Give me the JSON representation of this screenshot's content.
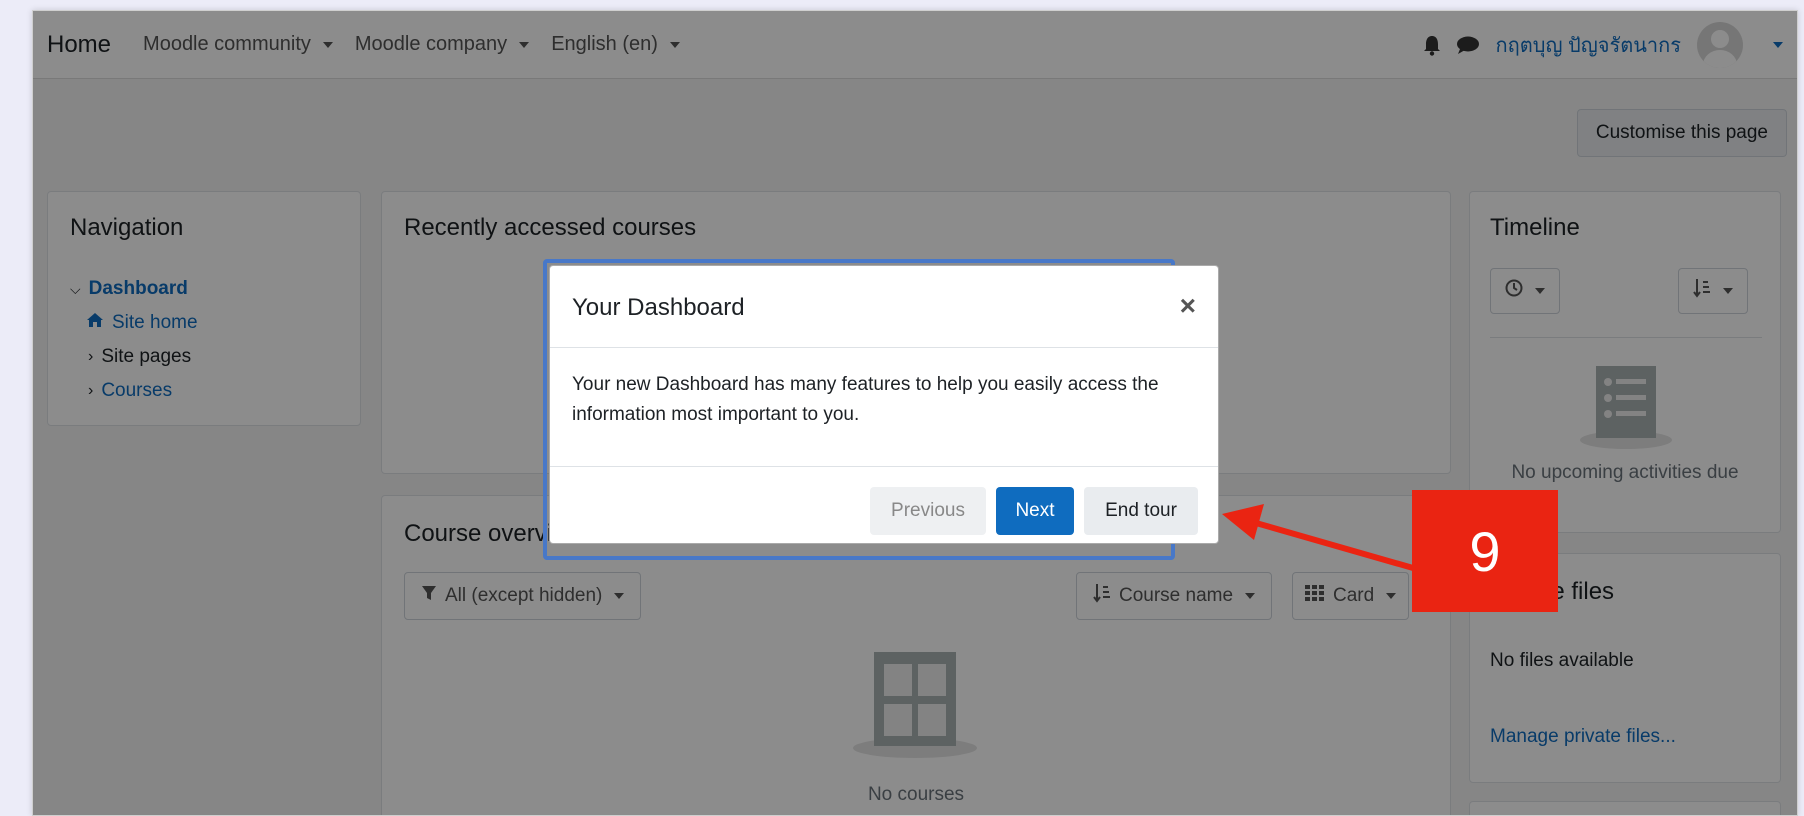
{
  "navbar": {
    "brand": "Home",
    "menu": [
      {
        "label": "Moodle community"
      },
      {
        "label": "Moodle company"
      },
      {
        "label": "English (en)"
      }
    ],
    "user_name": "กฤตบุญ ปัญจรัตนากร"
  },
  "customise_button": "Customise this page",
  "navigation": {
    "title": "Navigation",
    "items": [
      {
        "label": "Dashboard"
      },
      {
        "label": "Site home"
      },
      {
        "label": "Site pages"
      },
      {
        "label": "Courses"
      }
    ]
  },
  "recent_courses": {
    "title": "Recently accessed courses"
  },
  "course_overview": {
    "title": "Course overview",
    "filter_label": "All (except hidden)",
    "sort_label": "Course name",
    "view_label": "Card",
    "empty_text": "No courses"
  },
  "timeline": {
    "title": "Timeline",
    "empty_text": "No upcoming activities due"
  },
  "private_files": {
    "title": "Private files",
    "empty_text": "No files available",
    "manage_link": "Manage private files..."
  },
  "tour": {
    "title": "Your Dashboard",
    "close_symbol": "×",
    "body": "Your new Dashboard has many features to help you easily access the information most important to you.",
    "previous_label": "Previous",
    "next_label": "Next",
    "end_label": "End tour"
  },
  "annotation": {
    "step_number": "9",
    "color": "#ea2412"
  }
}
